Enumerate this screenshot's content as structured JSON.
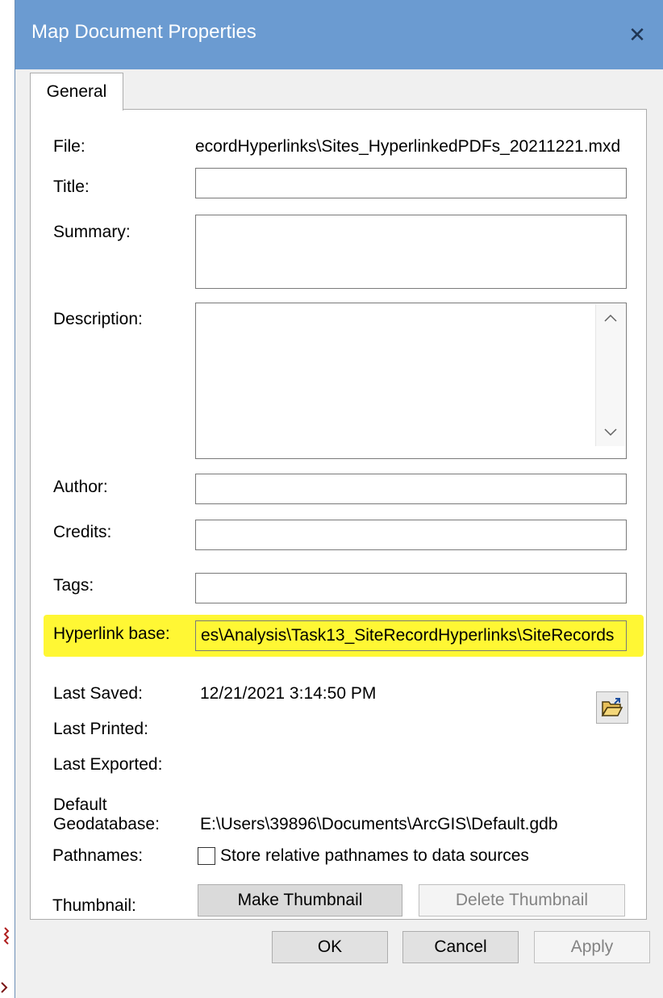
{
  "window": {
    "title": "Map Document Properties",
    "close_glyph": "✕"
  },
  "tabs": [
    {
      "label": "General"
    }
  ],
  "fields": {
    "file": {
      "label": "File:",
      "value": "ecordHyperlinks\\Sites_HyperlinkedPDFs_20211221.mxd"
    },
    "title": {
      "label": "Title:",
      "value": ""
    },
    "summary": {
      "label": "Summary:",
      "value": ""
    },
    "description": {
      "label": "Description:",
      "value": ""
    },
    "author": {
      "label": "Author:",
      "value": ""
    },
    "credits": {
      "label": "Credits:",
      "value": ""
    },
    "tags": {
      "label": "Tags:",
      "value": ""
    },
    "hyperlink_base": {
      "label": "Hyperlink base:",
      "value": "es\\Analysis\\Task13_SiteRecordHyperlinks\\SiteRecords"
    },
    "last_saved": {
      "label": "Last Saved:",
      "value": "12/21/2021 3:14:50 PM"
    },
    "last_printed": {
      "label": "Last Printed:",
      "value": ""
    },
    "last_exported": {
      "label": "Last Exported:",
      "value": ""
    },
    "default_geodatabase": {
      "label_line1": "Default",
      "label_line2": "Geodatabase:",
      "value": "E:\\Users\\39896\\Documents\\ArcGIS\\Default.gdb"
    },
    "pathnames": {
      "label": "Pathnames:",
      "checkbox_label": "Store relative pathnames to data sources",
      "checked": false
    },
    "thumbnail": {
      "label": "Thumbnail:",
      "make_label": "Make Thumbnail",
      "delete_label": "Delete Thumbnail"
    }
  },
  "buttons": {
    "ok": "OK",
    "cancel": "Cancel",
    "apply": "Apply"
  },
  "colors": {
    "titlebar": "#6b9bd1",
    "highlight": "#fff734",
    "panel": "#ffffff",
    "chrome": "#f0f0f0"
  },
  "icons": [
    "close-icon",
    "scroll-up-icon",
    "scroll-down-icon",
    "folder-open-icon"
  ]
}
